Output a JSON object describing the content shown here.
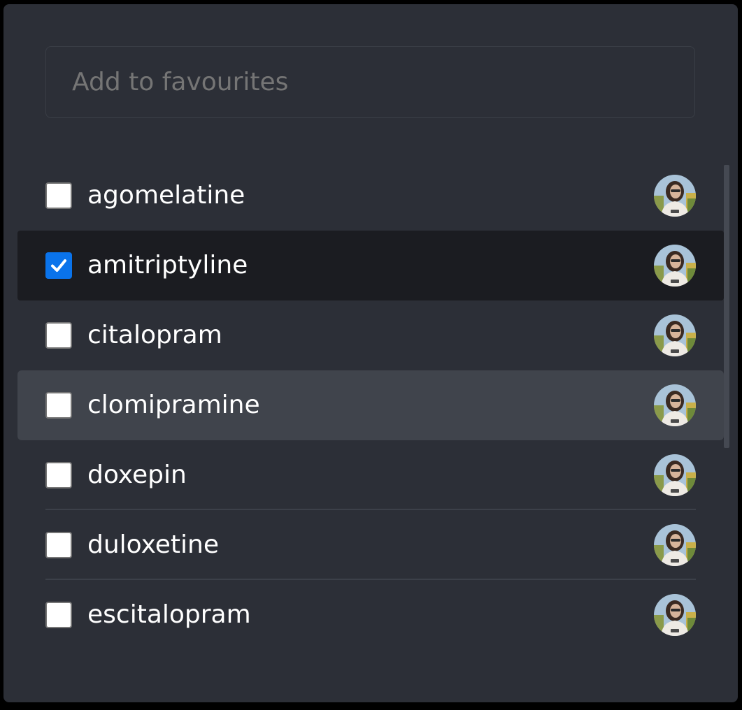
{
  "search": {
    "placeholder": "Add to favourites",
    "value": ""
  },
  "items": [
    {
      "label": "agomelatine",
      "checked": false
    },
    {
      "label": "amitriptyline",
      "checked": true
    },
    {
      "label": "citalopram",
      "checked": false
    },
    {
      "label": "clomipramine",
      "checked": false
    },
    {
      "label": "doxepin",
      "checked": false
    },
    {
      "label": "duloxetine",
      "checked": false
    },
    {
      "label": "escitalopram",
      "checked": false
    }
  ],
  "colors": {
    "panel_background": "#2c2f37",
    "selected_row": "#1b1c21",
    "hovered_row": "#40444c",
    "checkbox_checked": "#0a73eb",
    "text": "#ffffff",
    "placeholder": "#757575"
  },
  "icons": {
    "avatar": "user-avatar-photo",
    "checkmark": "check-icon"
  }
}
